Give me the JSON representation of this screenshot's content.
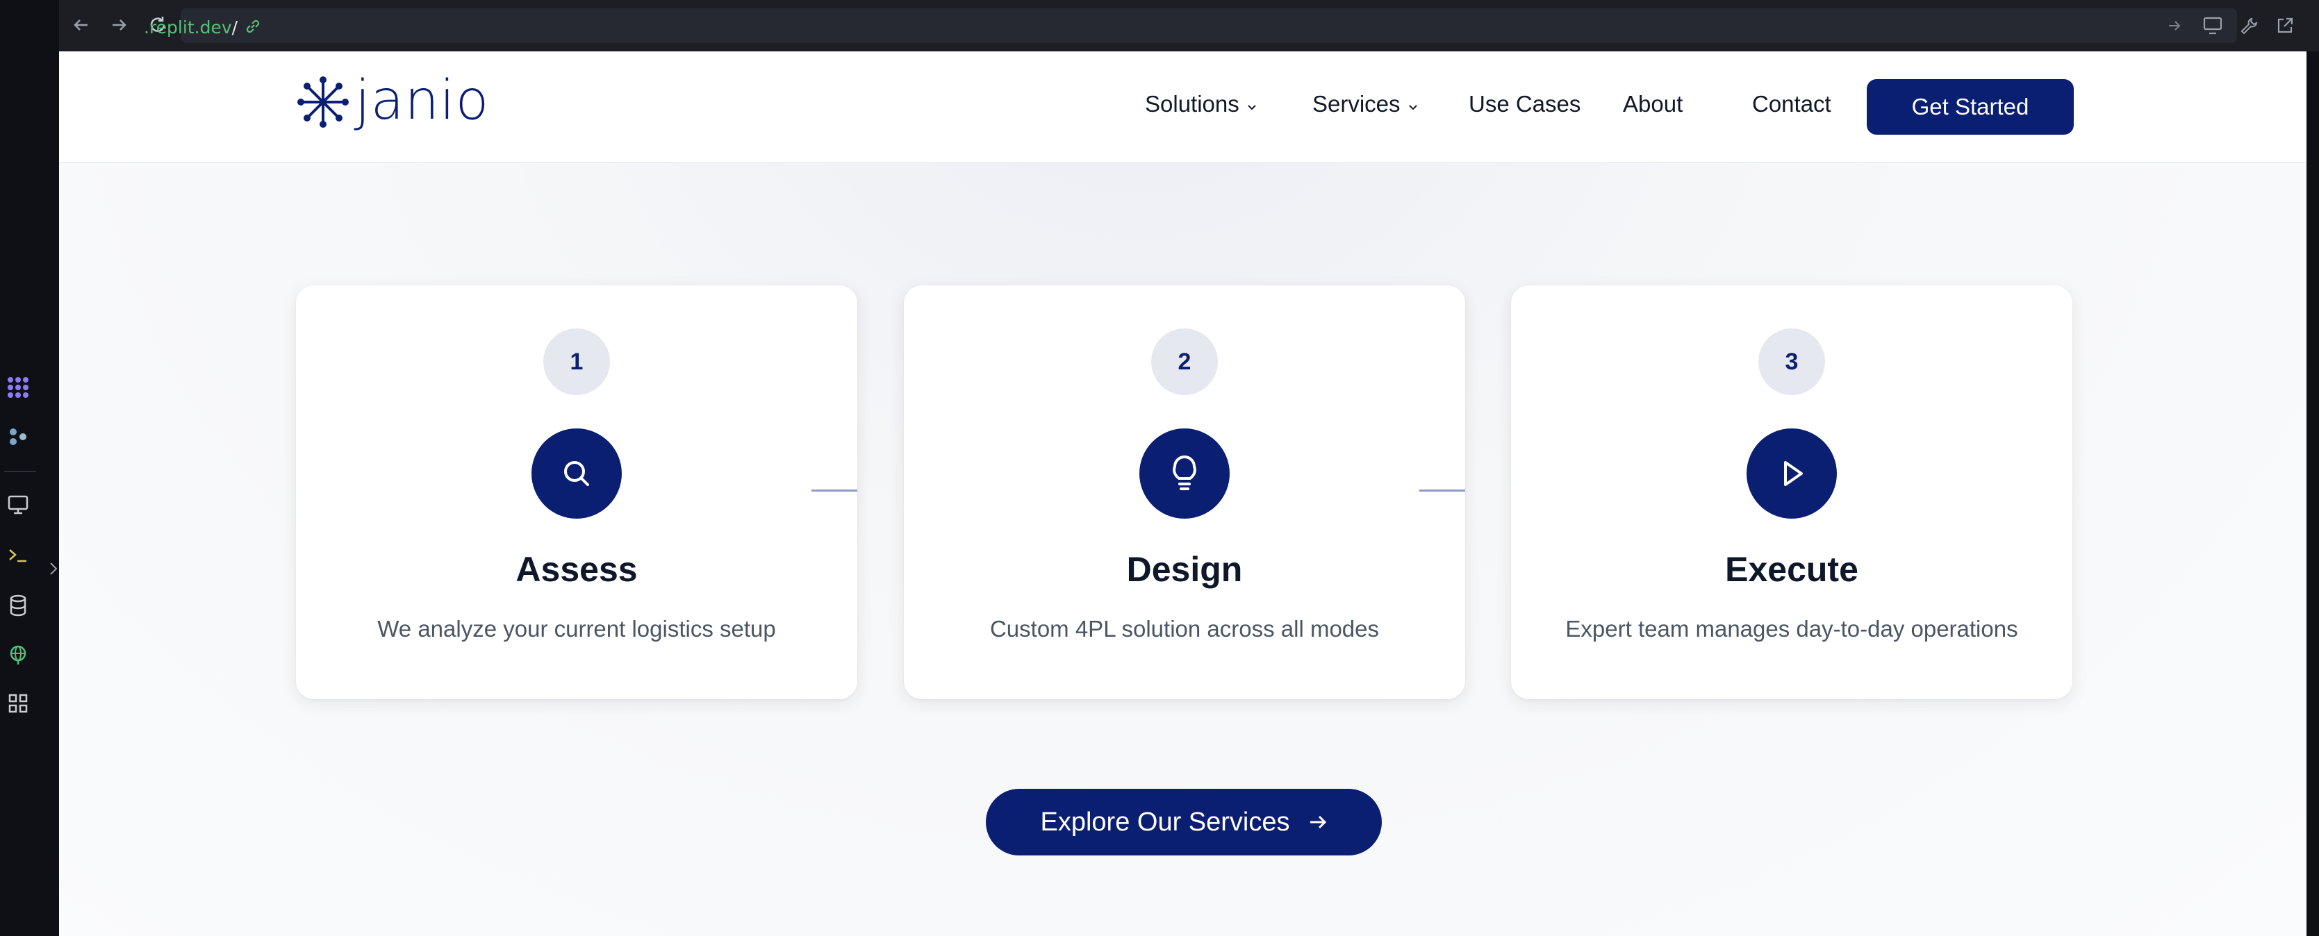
{
  "browser": {
    "url_domain": ".replit.dev",
    "url_path": "/"
  },
  "site": {
    "logo_text": "janio",
    "nav": {
      "solutions": "Solutions",
      "services": "Services",
      "use_cases": "Use Cases",
      "about": "About",
      "contact": "Contact"
    },
    "cta_label": "Get Started"
  },
  "steps": [
    {
      "number": "1",
      "title": "Assess",
      "description": "We analyze your current logistics setup",
      "icon": "search-icon"
    },
    {
      "number": "2",
      "title": "Design",
      "description": "Custom 4PL solution across all modes",
      "icon": "lightbulb-icon"
    },
    {
      "number": "3",
      "title": "Execute",
      "description": "Expert team manages day-to-day operations",
      "icon": "play-icon"
    }
  ],
  "explore_label": "Explore Our Services",
  "colors": {
    "brand": "#0b1f72",
    "connector": "#8e9bc9",
    "step_badge_bg": "#e6e8f0"
  }
}
